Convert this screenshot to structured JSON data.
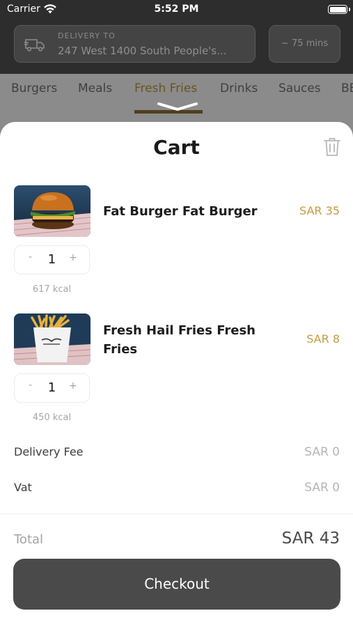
{
  "status_bar": {
    "carrier": "Carrier",
    "time": "5:52 PM"
  },
  "delivery": {
    "caption": "DELIVERY TO",
    "address": "247 West 1400 South People's...",
    "eta": "~ 75 mins"
  },
  "categories": [
    {
      "label": "Burgers"
    },
    {
      "label": "Meals"
    },
    {
      "label": "Fresh Fries",
      "active": true
    },
    {
      "label": "Drinks"
    },
    {
      "label": "Sauces"
    },
    {
      "label": "BE"
    }
  ],
  "cart": {
    "title": "Cart",
    "items": [
      {
        "name": "Fat Burger Fat Burger",
        "price": "SAR 35",
        "minus": "-",
        "quantity": "1",
        "plus": "+",
        "calories": "617 kcal",
        "image": "burger-photo"
      },
      {
        "name": "Fresh Hail Fries Fresh Fries",
        "price": "SAR 8",
        "minus": "-",
        "quantity": "1",
        "plus": "+",
        "calories": "450 kcal",
        "image": "fries-cup-photo"
      }
    ],
    "delivery_fee_label": "Delivery Fee",
    "delivery_fee_value": "SAR 0",
    "vat_label": "Vat",
    "vat_value": "SAR 0",
    "total_label": "Total",
    "total_value": "SAR 43",
    "checkout_label": "Checkout"
  },
  "colors": {
    "accent_price": "#c69b3f",
    "checkout_bg": "#4a4a4a",
    "topbar_bg": "#2d2d2d"
  }
}
